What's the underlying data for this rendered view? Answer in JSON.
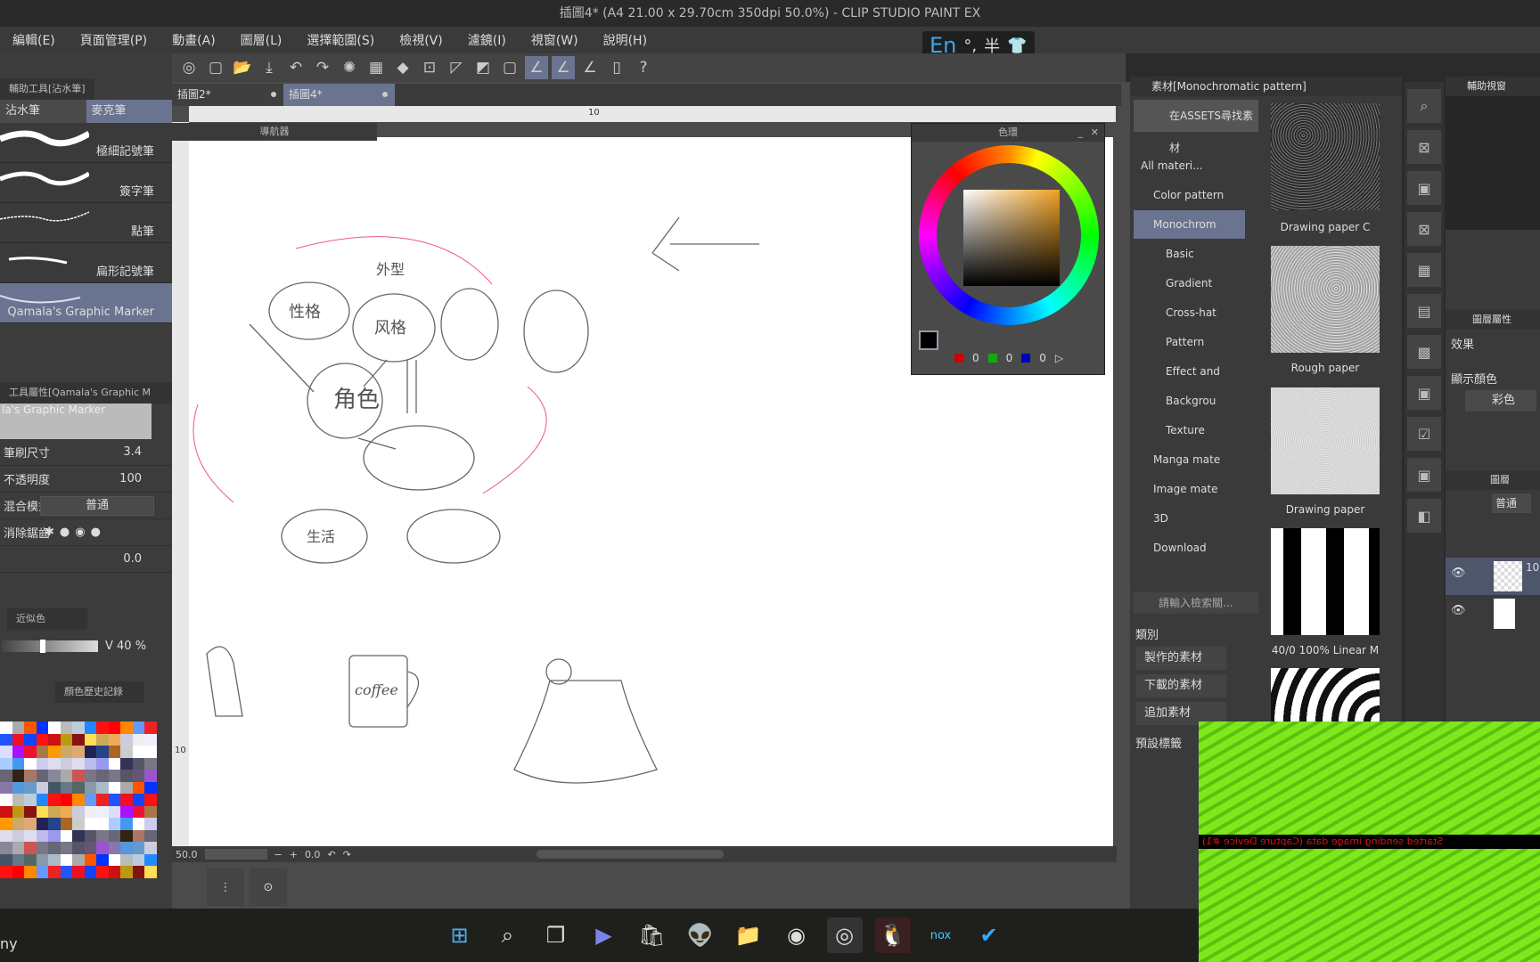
{
  "window": {
    "title": "插圖4* (A4 21.00 x 29.70cm 350dpi 50.0%) - CLIP STUDIO PAINT EX"
  },
  "menu": [
    "編輯(E)",
    "頁面管理(P)",
    "動畫(A)",
    "圖層(L)",
    "選擇範圍(S)",
    "檢視(V)",
    "濾鏡(I)",
    "視窗(W)",
    "說明(H)"
  ],
  "ime": {
    "lang": "En",
    "punct": "°,",
    "width": "半",
    "icon": "shirt-icon"
  },
  "left": {
    "subtool_header": "輔助工具[沾水筆]",
    "tabs": [
      "沾水筆",
      "麥克筆"
    ],
    "brushes": [
      "極細記號筆",
      "簽字筆",
      "點筆",
      "扁形記號筆",
      "Qamala's Graphic Marker"
    ],
    "props_header": "工具屬性[Qamala's Graphic M",
    "preview_name": "la's Graphic Marker",
    "props": [
      {
        "label": "筆刷尺寸",
        "value": "3.4"
      },
      {
        "label": "不透明度",
        "value": "100"
      },
      {
        "label": "混合模式",
        "value": "普通"
      },
      {
        "label": "消除鋸齒",
        "value": ""
      },
      {
        "label": "",
        "value": "0.0"
      }
    ],
    "approx_tab": "近似色",
    "v_label": "V 40 %",
    "v_value": 40,
    "history_tab": "顏色歷史記錄",
    "taskbar_text": "ny"
  },
  "doc_tabs": [
    "插圖2*",
    "插圖4*"
  ],
  "ruler": {
    "mark": "10",
    "vmark": "10"
  },
  "nav_panel": {
    "title": "導航器"
  },
  "color_panel": {
    "title": "色環",
    "r": "0",
    "g": "0",
    "b": "0",
    "hue_color": "#f0a020"
  },
  "status": {
    "zoom": "50.0",
    "angle": "0.0"
  },
  "sketch": {
    "center": "角色",
    "a": "性格",
    "b": "风格",
    "c": "外型",
    "d": "生活",
    "mug": "coffee"
  },
  "material": {
    "title": "素材[Monochromatic pattern]",
    "assets_btn": "在ASSETS尋找素材",
    "tree": [
      "All materi...",
      "Color pattern",
      "Monochrom",
      "Basic",
      "Gradient",
      "Cross-hat",
      "Pattern",
      "Effect and",
      "Backgrou",
      "Texture",
      "Manga mate",
      "Image mate",
      "3D",
      "Download"
    ],
    "thumbs": [
      "Drawing paper C",
      "Rough paper",
      "Drawing paper",
      "40/0 100% Linear M"
    ],
    "search_placeholder": "請輸入檢索關...",
    "category_label": "類別",
    "categories": [
      "製作的素材",
      "下載的素材",
      "追加素材"
    ],
    "preset_label": "預設標籤"
  },
  "right": {
    "subview": "輔助視窗",
    "layer_prop": "圖層屬性",
    "effect": "效果",
    "display_color": "顯示顏色",
    "color_mode": "彩色",
    "layer": "圖層",
    "blend": "普通",
    "layer1": "10"
  },
  "overlay": {
    "message": "Started sending image data (Capture Device #1)"
  }
}
